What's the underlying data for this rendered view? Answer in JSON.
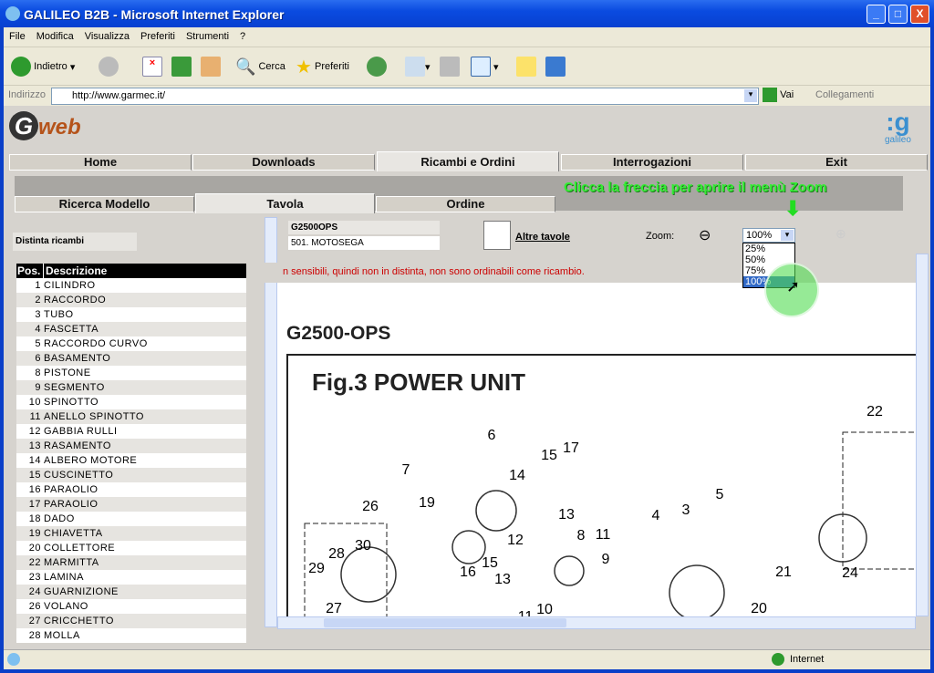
{
  "window": {
    "title": "GALILEO B2B - Microsoft Internet Explorer"
  },
  "menu": [
    "File",
    "Modifica",
    "Visualizza",
    "Preferiti",
    "Strumenti",
    "?"
  ],
  "toolbar": {
    "back": "Indietro",
    "search": "Cerca",
    "favorites": "Preferiti"
  },
  "address": {
    "label": "Indirizzo",
    "url": "http://www.garmec.it/",
    "go": "Vai",
    "links": "Collegamenti"
  },
  "app": {
    "logo": "Gweb",
    "brand": "galileo",
    "nav": [
      "Home",
      "Downloads",
      "Ricambi e Ordini",
      "Interrogazioni",
      "Exit"
    ],
    "nav_active": 2,
    "subtabs": [
      "Ricerca Modello",
      "Tavola",
      "Ordine"
    ],
    "subtab_active": 1,
    "hint": "Clicca la freccia per aprire il menù Zoom"
  },
  "sidebar": {
    "title": "Distinta ricambi",
    "headers": [
      "Pos.",
      "Descrizione"
    ],
    "rows": [
      [
        "1",
        "CILINDRO"
      ],
      [
        "2",
        "RACCORDO"
      ],
      [
        "3",
        "TUBO"
      ],
      [
        "4",
        "FASCETTA"
      ],
      [
        "5",
        "RACCORDO CURVO"
      ],
      [
        "6",
        "BASAMENTO"
      ],
      [
        "8",
        "PISTONE"
      ],
      [
        "9",
        "SEGMENTO"
      ],
      [
        "10",
        "SPINOTTO"
      ],
      [
        "11",
        "ANELLO SPINOTTO"
      ],
      [
        "12",
        "GABBIA RULLI"
      ],
      [
        "13",
        "RASAMENTO"
      ],
      [
        "14",
        "ALBERO MOTORE"
      ],
      [
        "15",
        "CUSCINETTO"
      ],
      [
        "16",
        "PARAOLIO"
      ],
      [
        "17",
        "PARAOLIO"
      ],
      [
        "18",
        "DADO"
      ],
      [
        "19",
        "CHIAVETTA"
      ],
      [
        "20",
        "COLLETTORE"
      ],
      [
        "22",
        "MARMITTA"
      ],
      [
        "23",
        "LAMINA"
      ],
      [
        "24",
        "GUARNIZIONE"
      ],
      [
        "26",
        "VOLANO"
      ],
      [
        "27",
        "CRICCHETTO"
      ],
      [
        "28",
        "MOLLA"
      ]
    ]
  },
  "main": {
    "model_code": "G2500OPS",
    "model_name": "501. MOTOSEGA",
    "other_tables": "Altre tavole",
    "zoom_label": "Zoom:",
    "zoom_value": "100%",
    "zoom_options": [
      "25%",
      "50%",
      "75%",
      "100%"
    ],
    "zoom_highlighted": "100%",
    "notice": "n sensibili, quindi non in distinta, non sono ordinabili come ricambio.",
    "drawing_title": "G2500-OPS",
    "figure_title": "Fig.3 POWER UNIT",
    "callouts": [
      "22",
      "6",
      "15",
      "17",
      "7",
      "14",
      "19",
      "26",
      "13",
      "12",
      "8",
      "11",
      "15",
      "9",
      "16",
      "13",
      "4",
      "3",
      "5",
      "21",
      "24",
      "20",
      "29",
      "28",
      "30",
      "27",
      "10",
      "11"
    ]
  },
  "status": {
    "zone": "Internet"
  },
  "colors": {
    "hint": "#33ee33",
    "header_bg": "#000000",
    "notice": "#cc0000",
    "titlebar": "#0a4be0"
  }
}
